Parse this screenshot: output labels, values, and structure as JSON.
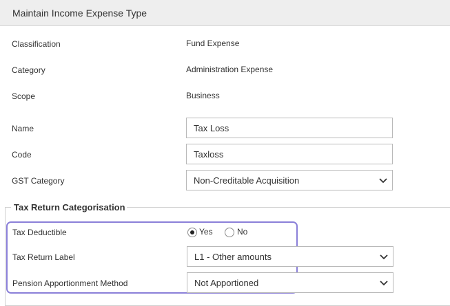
{
  "header": {
    "title": "Maintain Income Expense Type"
  },
  "info": {
    "classification": {
      "label": "Classification",
      "value": "Fund Expense"
    },
    "category": {
      "label": "Category",
      "value": "Administration Expense"
    },
    "scope": {
      "label": "Scope",
      "value": "Business"
    }
  },
  "form": {
    "name": {
      "label": "Name",
      "value": "Tax Loss"
    },
    "code": {
      "label": "Code",
      "value": "Taxloss"
    },
    "gst_category": {
      "label": "GST Category",
      "value": "Non-Creditable Acquisition"
    }
  },
  "tax_return": {
    "legend": "Tax Return Categorisation",
    "tax_deductible": {
      "label": "Tax Deductible",
      "options": [
        "Yes",
        "No"
      ],
      "selected": "Yes"
    },
    "tax_return_label": {
      "label": "Tax Return Label",
      "value": "L1 - Other amounts"
    },
    "pension_method": {
      "label": "Pension Apportionment Method",
      "value": "Not Apportioned"
    }
  },
  "colors": {
    "highlight_border": "#8a7fd8",
    "header_bg": "#eeeeee"
  }
}
